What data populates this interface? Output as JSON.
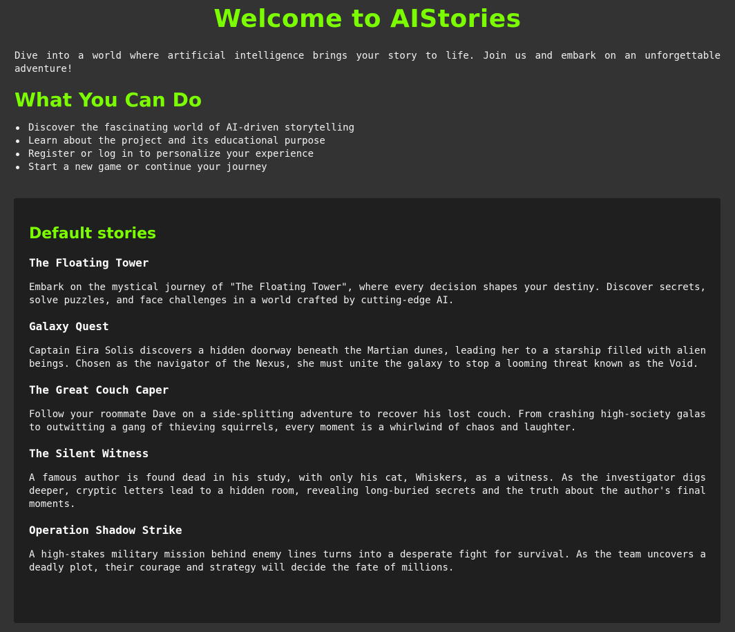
{
  "header": {
    "title": "Welcome to AIStories",
    "intro": "Dive into a world where artificial intelligence brings your story to life. Join us and embark on an unforgettable adventure!"
  },
  "features": {
    "title": "What You Can Do",
    "items": [
      "Discover the fascinating world of AI-driven storytelling",
      "Learn about the project and its educational purpose",
      "Register or log in to personalize your experience",
      "Start a new game or continue your journey"
    ]
  },
  "stories": {
    "title": "Default stories",
    "items": [
      {
        "title": "The Floating Tower",
        "description": "Embark on the mystical journey of \"The Floating Tower\", where every decision shapes your destiny. Discover secrets, solve puzzles, and face challenges in a world crafted by cutting-edge AI."
      },
      {
        "title": "Galaxy Quest",
        "description": "Captain Eira Solis discovers a hidden doorway beneath the Martian dunes, leading her to a starship filled with alien beings. Chosen as the navigator of the Nexus, she must unite the galaxy to stop a looming threat known as the Void."
      },
      {
        "title": "The Great Couch Caper",
        "description": "Follow your roommate Dave on a side-splitting adventure to recover his lost couch. From crashing high-society galas to outwitting a gang of thieving squirrels, every moment is a whirlwind of chaos and laughter."
      },
      {
        "title": "The Silent Witness",
        "description": "A famous author is found dead in his study, with only his cat, Whiskers, as a witness. As the investigator digs deeper, cryptic letters lead to a hidden room, revealing long-buried secrets and the truth about the author's final moments."
      },
      {
        "title": "Operation Shadow Strike",
        "description": "A high-stakes military mission behind enemy lines turns into a desperate fight for survival. As the team uncovers a deadly plot, their courage and strategy will decide the fate of millions."
      }
    ]
  },
  "colors": {
    "background": "#333333",
    "panel": "#1f1f1f",
    "accent": "#7cfc00",
    "text": "#f0f0f0"
  }
}
